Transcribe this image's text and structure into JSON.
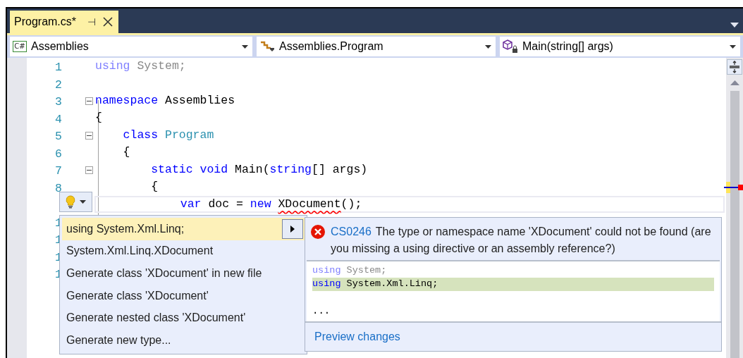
{
  "tabs": [
    {
      "label": "Program.cs*",
      "selected": true,
      "pin": "⊣"
    }
  ],
  "nav": [
    {
      "kind": "project",
      "icon_text": "C#",
      "label": "Assemblies"
    },
    {
      "kind": "class",
      "label": "Assemblies.Program"
    },
    {
      "kind": "method",
      "label": "Main(string[] args)"
    }
  ],
  "editor": {
    "lines": [
      {
        "number": "1",
        "fold": false,
        "current": false,
        "tokens": [
          {
            "text": "using",
            "kind": "unused-keyword"
          },
          {
            "text": " System;",
            "kind": "unused"
          }
        ]
      },
      {
        "number": "2",
        "fold": false,
        "current": false
      },
      {
        "number": "3",
        "fold": true,
        "current": false,
        "tokens": [
          {
            "text": "namespace",
            "kind": "keyword"
          },
          {
            "text": " Assemblies",
            "kind": "plain"
          }
        ]
      },
      {
        "number": "4",
        "fold": false,
        "current": false,
        "tokens": [
          {
            "text": "{",
            "kind": "plain"
          }
        ]
      },
      {
        "number": "5",
        "fold": true,
        "current": false,
        "tokens": [
          {
            "text": "class",
            "kind": "keyword"
          },
          {
            "text": " Program",
            "kind": "type"
          }
        ]
      },
      {
        "number": "6",
        "fold": false,
        "current": false,
        "tokens": [
          {
            "text": "{",
            "kind": "plain"
          }
        ]
      },
      {
        "number": "7",
        "fold": true,
        "current": false,
        "tokens": [
          {
            "text": "static",
            "kind": "keyword"
          },
          {
            "text": " void",
            "kind": "keyword"
          },
          {
            "text": " Main(",
            "kind": "plain"
          },
          {
            "text": "string",
            "kind": "keyword"
          },
          {
            "text": "[] args)",
            "kind": "plain"
          }
        ]
      },
      {
        "number": "8",
        "fold": false,
        "current": false,
        "tokens": [
          {
            "text": "{",
            "kind": "plain"
          }
        ]
      },
      {
        "fold": false,
        "current": true,
        "tokens": [
          {
            "text": "var",
            "kind": "keyword"
          },
          {
            "text": " doc = ",
            "kind": "plain"
          },
          {
            "text": "new ",
            "kind": "keyword"
          },
          {
            "text": "XDocument",
            "kind": "error"
          },
          {
            "text": "();",
            "kind": "plain"
          }
        ]
      },
      {
        "number": "1",
        "fold": false,
        "current": false
      },
      {
        "number": "1",
        "fold": false,
        "current": false
      },
      {
        "number": "1",
        "fold": false,
        "current": false
      },
      {
        "number": "1",
        "fold": false,
        "current": false
      }
    ]
  },
  "quick_actions": {
    "items": [
      {
        "label": "using System.Xml.Linq;",
        "selected": true
      },
      {
        "label": "System.Xml.Linq.XDocument",
        "selected": false
      },
      {
        "label": "Generate class 'XDocument' in new file",
        "selected": false
      },
      {
        "label": "Generate class 'XDocument'",
        "selected": false
      },
      {
        "label": "Generate nested class 'XDocument'",
        "selected": false
      },
      {
        "label": "Generate new type...",
        "selected": false
      }
    ]
  },
  "preview": {
    "error_code": "CS0246",
    "message": "The type or namespace name 'XDocument' could not be found (are you missing a using directive or an assembly reference?)",
    "lines": [
      {
        "added": false,
        "tokens": [
          {
            "text": "using",
            "kind": "unused-keyword"
          },
          {
            "text": " System;",
            "kind": "unused"
          }
        ]
      },
      {
        "added": true,
        "tokens": [
          {
            "text": "using",
            "kind": "keyword"
          },
          {
            "text": " System.Xml.Linq;",
            "kind": "plain"
          }
        ]
      }
    ],
    "ellipsis": "...",
    "link": "Preview changes"
  }
}
